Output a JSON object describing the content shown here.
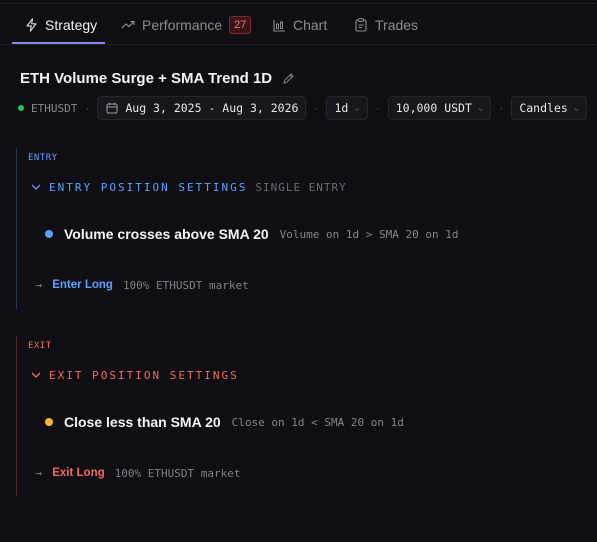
{
  "tabs": [
    {
      "label": "Strategy",
      "icon": "lightning-icon"
    },
    {
      "label": "Performance",
      "icon": "trend-icon",
      "badge": "27"
    },
    {
      "label": "Chart",
      "icon": "chart-icon"
    },
    {
      "label": "Trades",
      "icon": "clipboard-icon"
    }
  ],
  "strategy": {
    "title": "ETH Volume Surge + SMA Trend 1D",
    "symbol": "ETHUSDT",
    "date_range": "Aug 3, 2025 - Aug 3, 2026",
    "timeframe": "1d",
    "capital": "10,000 USDT",
    "chart_type": "Candles"
  },
  "entry": {
    "label": "ENTRY",
    "header": "ENTRY POSITION SETTINGS",
    "sub": "SINGLE ENTRY",
    "condition": "Volume crosses above SMA 20",
    "condition_desc": "Volume on 1d > SMA 20 on 1d",
    "action": "Enter Long",
    "action_desc": "100% ETHUSDT market",
    "color": "#5aa2ff"
  },
  "exit": {
    "label": "EXIT",
    "header": "EXIT POSITION SETTINGS",
    "condition": "Close less than SMA 20",
    "condition_desc": "Close on 1d < SMA 20 on 1d",
    "action": "Exit Long",
    "action_desc": "100% ETHUSDT market",
    "color": "#f26b5b"
  }
}
